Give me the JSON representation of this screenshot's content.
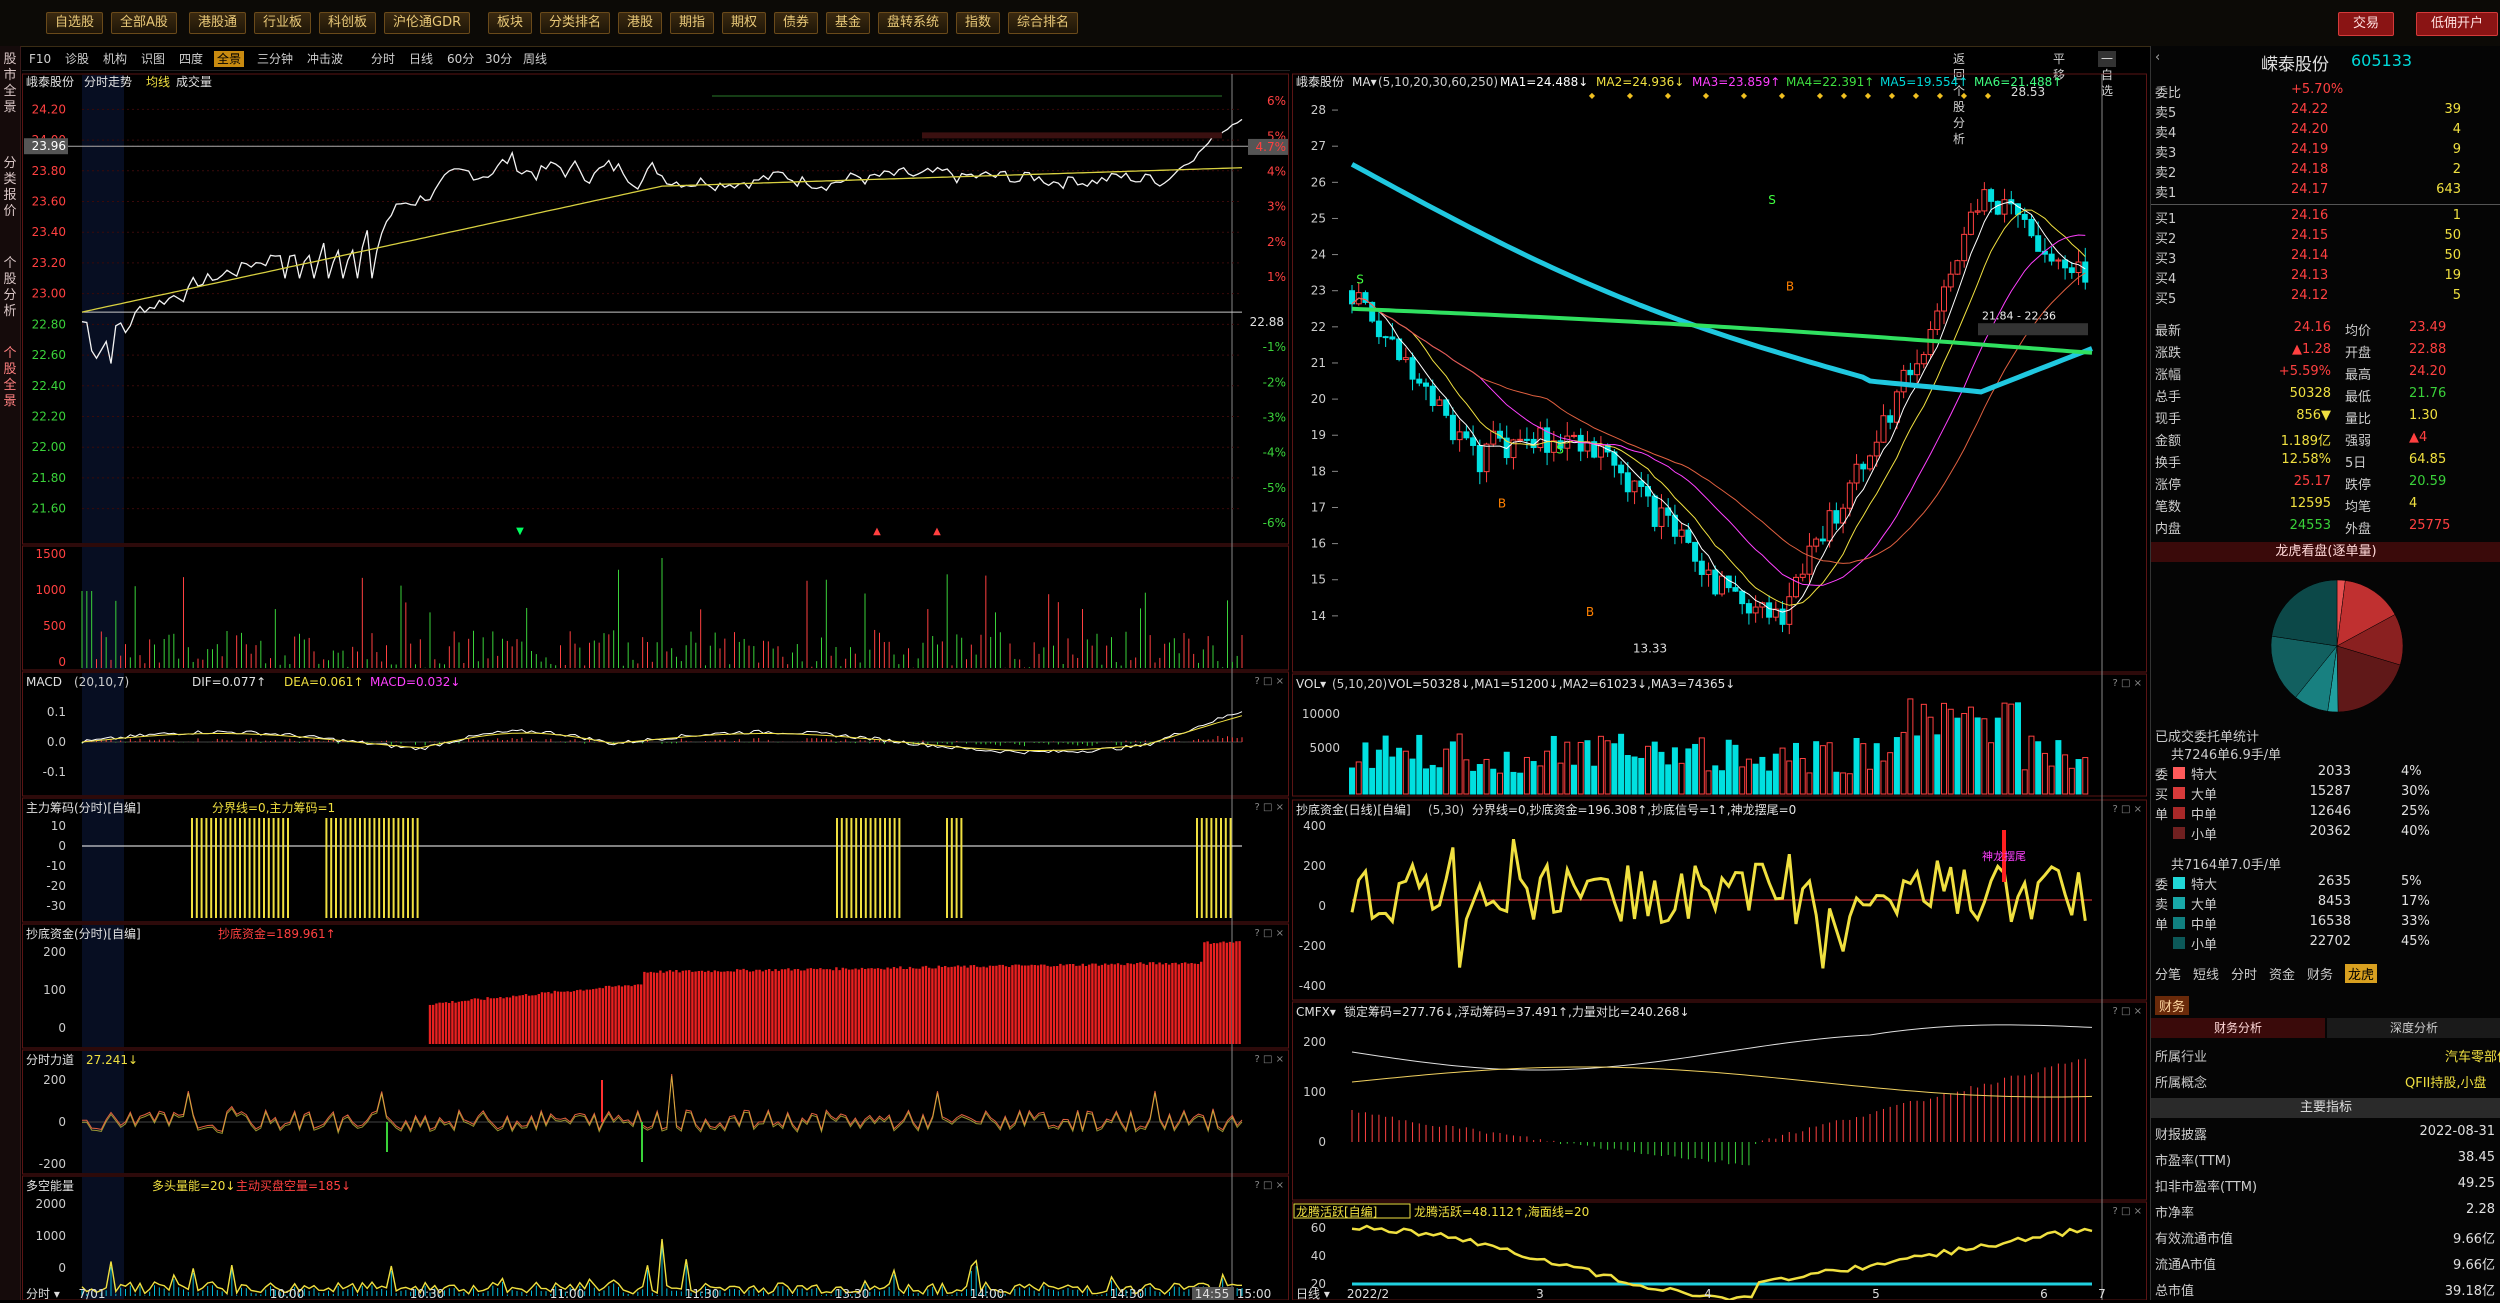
{
  "toolbar": {
    "buttons": [
      "自选股",
      "全部A股",
      "港股通",
      "行业板",
      "科创板",
      "沪伦通GDR",
      "板块",
      "分类排名",
      "港股",
      "期指",
      "期权",
      "债券",
      "基金",
      "盘转系统",
      "指数",
      "综合排名"
    ],
    "trade": "交易",
    "open_account": "低佣开户"
  },
  "left_tabs": [
    "股市全景",
    "分类报价",
    "个股分析",
    "个股全景"
  ],
  "tab_bar_left": [
    "F10",
    "诊股",
    "机构",
    "识图",
    "四度",
    "全景",
    "三分钟",
    "冲击波"
  ],
  "tab_bar_right": [
    "分时",
    "日线",
    "60分",
    "30分",
    "周线"
  ],
  "tab_bar_links": {
    "back": "返回个股分析",
    "flat": "平移",
    "watch": "一自选"
  },
  "intraday": {
    "title": "峨泰股份",
    "mode": "分时走势",
    "avg_label": "均线",
    "vol_label": "成交量",
    "price_ticks": [
      "24.20",
      "24.00",
      "23.96",
      "23.80",
      "23.60",
      "23.40",
      "23.20",
      "23.00",
      "22.80",
      "22.60",
      "22.40",
      "22.20",
      "22.00",
      "21.80",
      "21.60"
    ],
    "pct_ticks": [
      "6%",
      "5%",
      "4.7%",
      "4%",
      "3%",
      "2%",
      "1%",
      "",
      "-1%",
      "-2%",
      "-3%",
      "-4%",
      "-5%",
      "-6%"
    ],
    "base_price": "22.88",
    "vol_ticks": [
      "1500",
      "1000",
      "500",
      "0"
    ],
    "macd_title": "MACD",
    "macd_params": "(20,10,7)",
    "macd_dif": "DIF=0.077↑",
    "macd_dea": "DEA=0.061↑",
    "macd_val": "MACD=0.032↓",
    "macd_ticks": [
      "0.1",
      "0.0",
      "-0.1"
    ],
    "main_title": "主力筹码(分时)[自编]",
    "main_sep": "分界线=0,主力筹码=1",
    "main_ticks": [
      "10",
      "0",
      "-10",
      "-20",
      "-30"
    ],
    "bottom_title": "抄底资金(分时)[自编]",
    "bottom_val": "抄底资金=189.961↑",
    "bottom_ticks": [
      "200",
      "100",
      "0"
    ],
    "force_title": "分时力道",
    "force_val": "27.241↓",
    "force_ticks": [
      "200",
      "0",
      "-200"
    ],
    "ls_title": "多空能量",
    "ls_long": "多头量能=20↓",
    "ls_short": "主动买盘空量=185↓",
    "ls_ticks": [
      "2000",
      "1000",
      "0"
    ],
    "time_ticks": [
      "7/01",
      "10:00",
      "10:30",
      "11:00",
      "11:30",
      "13:30",
      "14:00",
      "14:30",
      "14:55",
      "15:00"
    ],
    "bottom_left": "分时"
  },
  "daily": {
    "title": "峨泰股份",
    "ma_label": "MA",
    "ma_params": "(5,10,20,30,60,250)",
    "ma1": "MA1=24.488↓",
    "ma2": "MA2=24.936↓",
    "ma3": "MA3=23.859↑",
    "ma4": "MA4=22.391↑",
    "ma5": "MA5=19.554↑",
    "ma6": "MA6=21.488↑",
    "price_ticks": [
      "28",
      "27",
      "26",
      "25",
      "24",
      "23",
      "22",
      "21",
      "20",
      "19",
      "18",
      "17",
      "16",
      "15",
      "14"
    ],
    "high_label": "28.53",
    "low_label": "13.33",
    "box_label": "21.84 - 22.36",
    "vol_title": "VOL",
    "vol_params": "(5,10,20)",
    "vol_vals": "VOL=50328↓,MA1=51200↓,MA2=61023↓,MA3=74365↓",
    "vol_ticks": [
      "10000",
      "5000"
    ],
    "cd_title": "抄底资金(日线)[自编]",
    "cd_params": "(5,30)",
    "cd_vals": "分界线=0,抄底资金=196.308↑,抄底信号=1↑,神龙摆尾=0",
    "cd_ticks": [
      "400",
      "200",
      "0",
      "-200",
      "-400"
    ],
    "cmfx_title": "CMFX",
    "cmfx_vals": "锁定筹码=277.76↓,浮动筹码=37.491↑,力量对比=240.268↓",
    "cmfx_ticks": [
      "200",
      "100",
      "0"
    ],
    "lt_title": "龙腾活跃[自编]",
    "lt_vals": "龙腾活跃=48.112↑,海面线=20",
    "lt_ticks": [
      "60",
      "40",
      "20"
    ],
    "date_ticks": [
      "2022/2",
      "3",
      "4",
      "5",
      "6",
      "7"
    ],
    "bottom_left": "日线",
    "tag_text": "神龙摆尾"
  },
  "quote": {
    "name": "嵘泰股份",
    "code": "605133",
    "weibi_label": "委比",
    "weibi": "+5.70%",
    "sell": [
      [
        "卖5",
        "24.22",
        "39"
      ],
      [
        "卖4",
        "24.20",
        "4"
      ],
      [
        "卖3",
        "24.19",
        "9"
      ],
      [
        "卖2",
        "24.18",
        "2"
      ],
      [
        "卖1",
        "24.17",
        "643"
      ]
    ],
    "buy": [
      [
        "买1",
        "24.16",
        "1"
      ],
      [
        "买2",
        "24.15",
        "50"
      ],
      [
        "买3",
        "24.14",
        "50"
      ],
      [
        "买4",
        "24.13",
        "19"
      ],
      [
        "买5",
        "24.12",
        "5"
      ]
    ],
    "side_labels": [
      "卖",
      "盘",
      "买",
      "盘"
    ],
    "stats": [
      [
        "最新",
        "24.16",
        "均价",
        "23.49"
      ],
      [
        "涨跌",
        "▲1.28",
        "开盘",
        "22.88"
      ],
      [
        "涨幅",
        "+5.59%",
        "最高",
        "24.20"
      ],
      [
        "总手",
        "50328",
        "最低",
        "21.76"
      ],
      [
        "现手",
        "856▼",
        "量比",
        "1.30"
      ],
      [
        "金额",
        "1.189亿",
        "强弱",
        "▲4"
      ],
      [
        "换手",
        "12.58%",
        "5日",
        "64.85"
      ],
      [
        "涨停",
        "25.17",
        "跌停",
        "20.59"
      ],
      [
        "笔数",
        "12595",
        "均笔",
        "4"
      ],
      [
        "内盘",
        "24553",
        "外盘",
        "25775"
      ]
    ],
    "pie_title": "龙虎看盘(逐单量)",
    "order_title": "已成交委托单统计",
    "buy_summary": "共7246单6.9手/单",
    "sell_summary": "共7164单7.0手/单",
    "buy_rows": [
      [
        "委",
        "特大",
        "2033",
        "4%"
      ],
      [
        "买",
        "大单",
        "15287",
        "30%"
      ],
      [
        "单",
        "中单",
        "12646",
        "25%"
      ],
      [
        "",
        "小单",
        "20362",
        "40%"
      ]
    ],
    "sell_rows": [
      [
        "委",
        "特大",
        "2635",
        "5%"
      ],
      [
        "卖",
        "大单",
        "8453",
        "17%"
      ],
      [
        "单",
        "中单",
        "16538",
        "33%"
      ],
      [
        "",
        "小单",
        "22702",
        "45%"
      ]
    ],
    "bottom_tabs": [
      "分笔",
      "短线",
      "分时",
      "资金",
      "财务",
      "龙虎"
    ],
    "fin_tab": "财务",
    "fin_sub": [
      "财务分析",
      "深度分析"
    ],
    "industry_label": "所属行业",
    "industry": "汽车零部件",
    "concept_label": "所属概念",
    "concept": "QFII持股,小盘",
    "main_index": "主要指标",
    "fin_rows": [
      [
        "财报披露",
        "2022-08-31"
      ],
      [
        "市盈率(TTM)",
        "38.45"
      ],
      [
        "扣非市盈率(TTM)",
        "49.25"
      ],
      [
        "市净率",
        "2.28"
      ],
      [
        "有效流通市值",
        "9.66亿"
      ],
      [
        "流通A市值",
        "9.66亿"
      ],
      [
        "总市值",
        "39.18亿"
      ]
    ]
  },
  "colors": {
    "up": "#ff3c3c",
    "down": "#00e0e0",
    "grid": "#5a1414",
    "yellow": "#f0e040"
  }
}
